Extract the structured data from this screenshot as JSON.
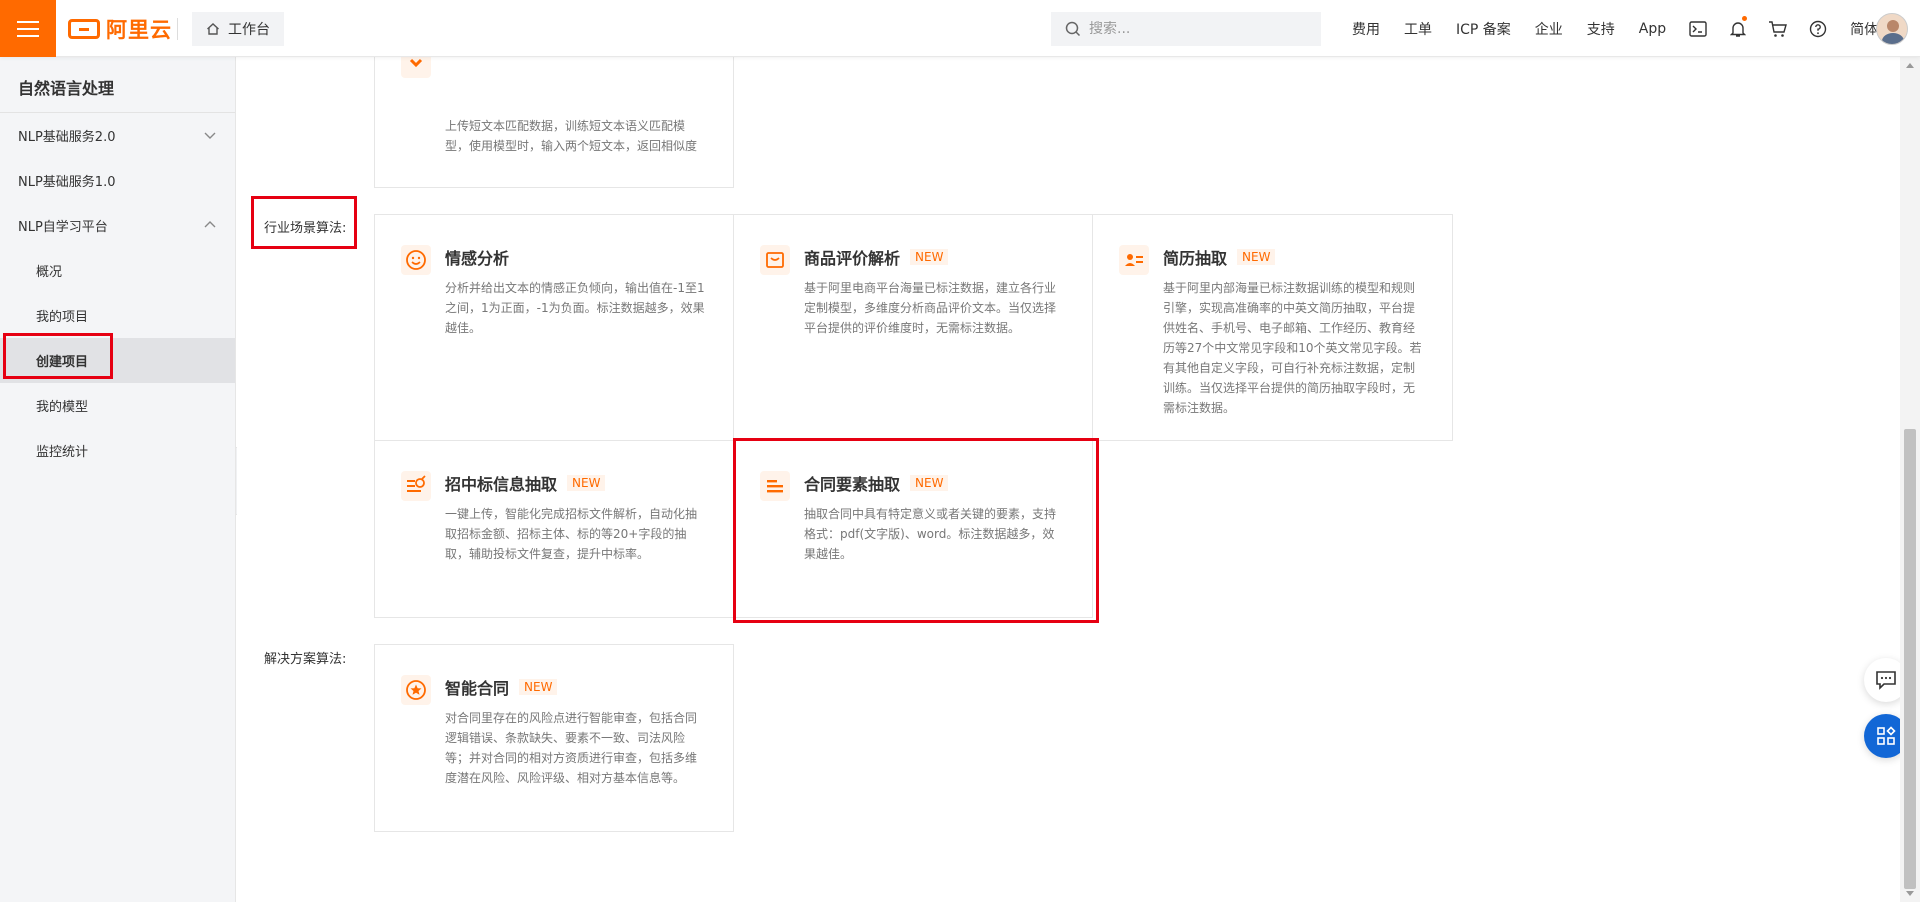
{
  "header": {
    "logo_text": "阿里云",
    "workbench_label": "工作台",
    "search_placeholder": "搜索...",
    "nav": {
      "fee": "费用",
      "ticket": "工单",
      "icp": "ICP 备案",
      "enterprise": "企业",
      "support": "支持",
      "app": "App",
      "lang": "简体"
    },
    "accent_color": "#ff6a00"
  },
  "sidebar": {
    "title": "自然语言处理",
    "items": [
      {
        "label": "NLP基础服务2.0"
      },
      {
        "label": "NLP基础服务1.0"
      },
      {
        "label": "NLP自学习平台"
      },
      {
        "label": "概况"
      },
      {
        "label": "我的项目"
      },
      {
        "label": "创建项目"
      },
      {
        "label": "我的模型"
      },
      {
        "label": "监控统计"
      }
    ]
  },
  "main": {
    "top_card_desc": "上传短文本匹配数据，训练短文本语义匹配模型，使用模型时，输入两个短文本，返回相似度",
    "industry_label": "行业场景算法:",
    "solution_label": "解决方案算法:",
    "new_badge": "NEW",
    "cards": [
      {
        "title": "情感分析",
        "desc": "分析并给出文本的情感正负倾向，输出值在-1至1之间，1为正面，-1为负面。标注数据越多，效果越佳。"
      },
      {
        "title": "商品评价解析",
        "desc": "基于阿里电商平台海量已标注数据，建立各行业定制模型，多维度分析商品评价文本。当仅选择平台提供的评价维度时，无需标注数据。"
      },
      {
        "title": "简历抽取",
        "desc": "基于阿里内部海量已标注数据训练的模型和规则引擎，实现高准确率的中英文简历抽取，平台提供姓名、手机号、电子邮箱、工作经历、教育经历等27个中文常见字段和10个英文常见字段。若有其他自定义字段，可自行补充标注数据，定制训练。当仅选择平台提供的简历抽取字段时，无需标注数据。"
      },
      {
        "title": "招中标信息抽取",
        "desc": "一键上传，智能化完成招标文件解析，自动化抽取招标金额、招标主体、标的等20+字段的抽取，辅助投标文件复查，提升中标率。"
      },
      {
        "title": "合同要素抽取",
        "desc": "抽取合同中具有特定意义或者关键的要素，支持格式：pdf(文字版)、word。标注数据越多，效果越佳。"
      },
      {
        "title": "智能合同",
        "desc": "对合同里存在的风险点进行智能审查，包括合同逻辑错误、条款缺失、要素不一致、司法风险等；并对合同的相对方资质进行审查，包括多维度潜在风险、风险评级、相对方基本信息等。"
      }
    ]
  }
}
